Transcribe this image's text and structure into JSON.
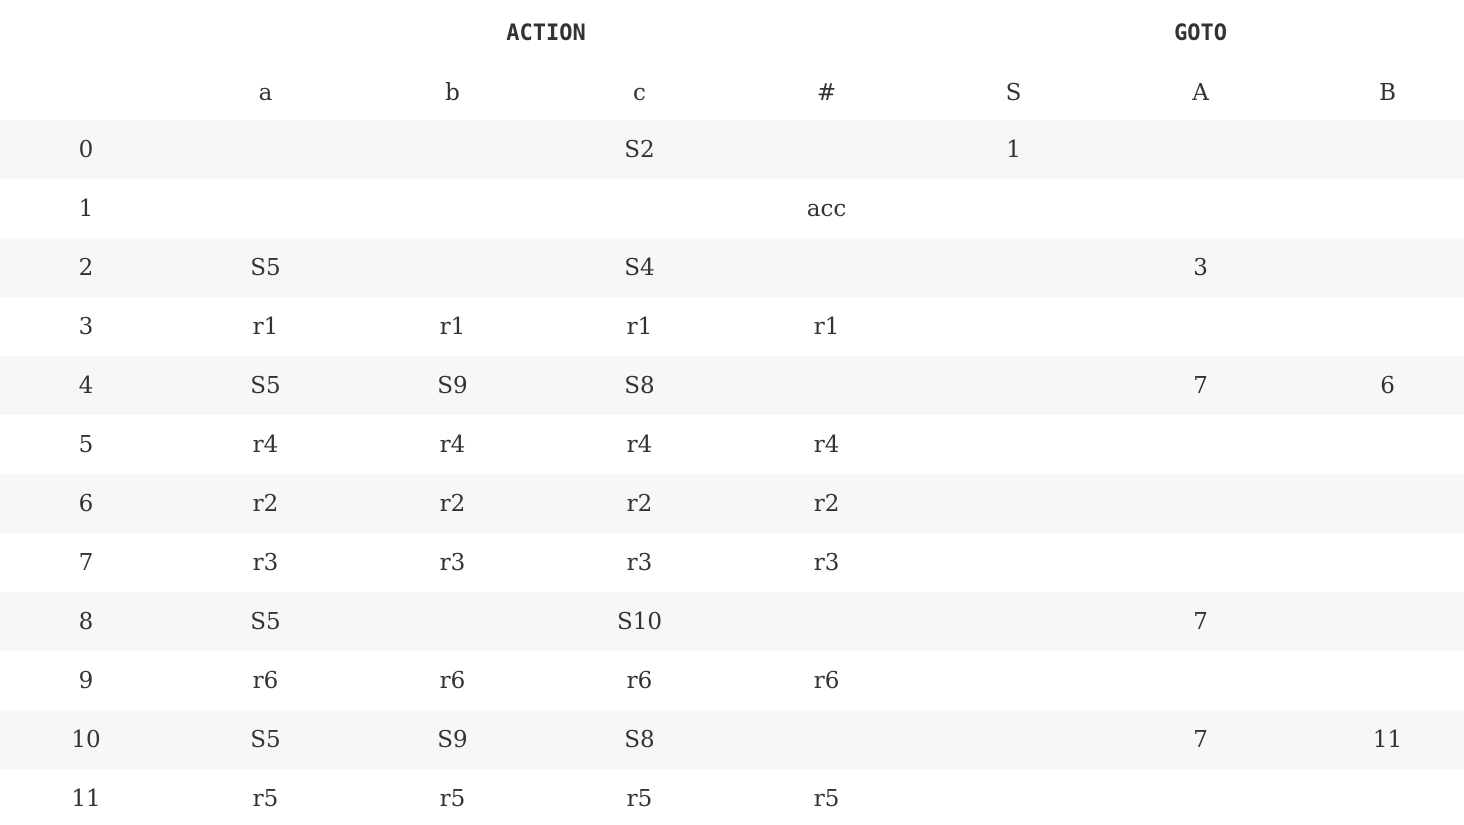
{
  "table": {
    "group_headers": {
      "corner": "",
      "action": "ACTION",
      "goto": "GOTO"
    },
    "symbol_headers": [
      "",
      "a",
      "b",
      "c",
      "#",
      "S",
      "A",
      "B"
    ],
    "rows": [
      [
        "0",
        "",
        "",
        "S2",
        "",
        "1",
        "",
        ""
      ],
      [
        "1",
        "",
        "",
        "",
        "acc",
        "",
        "",
        ""
      ],
      [
        "2",
        "S5",
        "",
        "S4",
        "",
        "",
        "3",
        ""
      ],
      [
        "3",
        "r1",
        "r1",
        "r1",
        "r1",
        "",
        "",
        ""
      ],
      [
        "4",
        "S5",
        "S9",
        "S8",
        "",
        "",
        "7",
        "6"
      ],
      [
        "5",
        "r4",
        "r4",
        "r4",
        "r4",
        "",
        "",
        ""
      ],
      [
        "6",
        "r2",
        "r2",
        "r2",
        "r2",
        "",
        "",
        ""
      ],
      [
        "7",
        "r3",
        "r3",
        "r3",
        "r3",
        "",
        "",
        ""
      ],
      [
        "8",
        "S5",
        "",
        "S10",
        "",
        "",
        "7",
        ""
      ],
      [
        "9",
        "r6",
        "r6",
        "r6",
        "r6",
        "",
        "",
        ""
      ],
      [
        "10",
        "S5",
        "S9",
        "S8",
        "",
        "",
        "7",
        "11"
      ],
      [
        "11",
        "r5",
        "r5",
        "r5",
        "r5",
        "",
        "",
        ""
      ]
    ]
  },
  "colors": {
    "text": "#333333",
    "stripe": "#f7f7f7",
    "background": "#ffffff"
  }
}
